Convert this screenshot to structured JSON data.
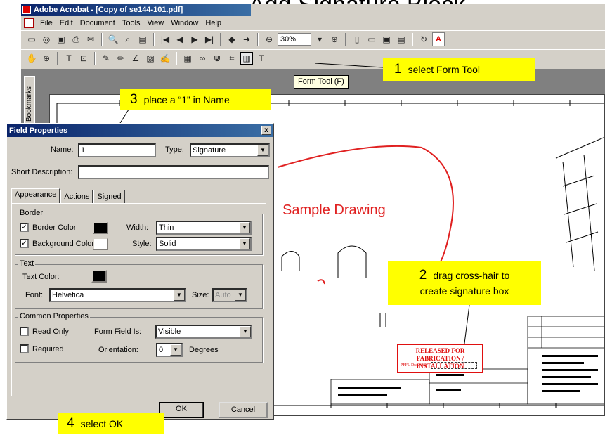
{
  "slide_title": "Add Signature Block",
  "window": {
    "title": "Adobe Acrobat - [Copy of se144-101.pdf]",
    "menu": [
      "File",
      "Edit",
      "Document",
      "Tools",
      "View",
      "Window",
      "Help"
    ],
    "zoom": "30%",
    "bookmarks_tab": "Bookmarks",
    "tooltip": "Form Tool (F)"
  },
  "callouts": {
    "c1_num": "1",
    "c1_text": "select Form Tool",
    "c2_num": "2",
    "c2_line1": "drag cross-hair to",
    "c2_line2": "create signature box",
    "c3_num": "3",
    "c3_text": "place a “1” in Name",
    "c4_num": "4",
    "c4_text": "select OK"
  },
  "drawing": {
    "sample_label": "Sample Drawing",
    "stamp_line1": "RELEASED FOR",
    "stamp_line2": "FABRICATION / INSTALLATION",
    "stamp_small": "PFFL Drawing:"
  },
  "dialog": {
    "title": "Field Properties",
    "close": "x",
    "name_label": "Name:",
    "name_value": "1",
    "type_label": "Type:",
    "type_value": "Signature",
    "short_desc_label": "Short Description:",
    "short_desc_value": "",
    "tabs": [
      "Appearance",
      "Actions",
      "Signed"
    ],
    "border_group": "Border",
    "border_color_label": "Border Color",
    "bg_color_label": "Background Color",
    "width_label": "Width:",
    "width_value": "Thin",
    "style_label": "Style:",
    "style_value": "Solid",
    "text_group": "Text",
    "text_color_label": "Text Color:",
    "font_label": "Font:",
    "font_value": "Helvetica",
    "size_label": "Size:",
    "size_value": "Auto",
    "common_group": "Common Properties",
    "read_only_label": "Read Only",
    "required_label": "Required",
    "form_field_is_label": "Form Field Is:",
    "form_field_is_value": "Visible",
    "orientation_label": "Orientation:",
    "orientation_value": "0",
    "degrees_label": "Degrees",
    "ok": "OK",
    "cancel": "Cancel"
  },
  "colors": {
    "callout": "#ffff00",
    "accent_red": "#e02020",
    "titlebar": "#0a246a"
  }
}
